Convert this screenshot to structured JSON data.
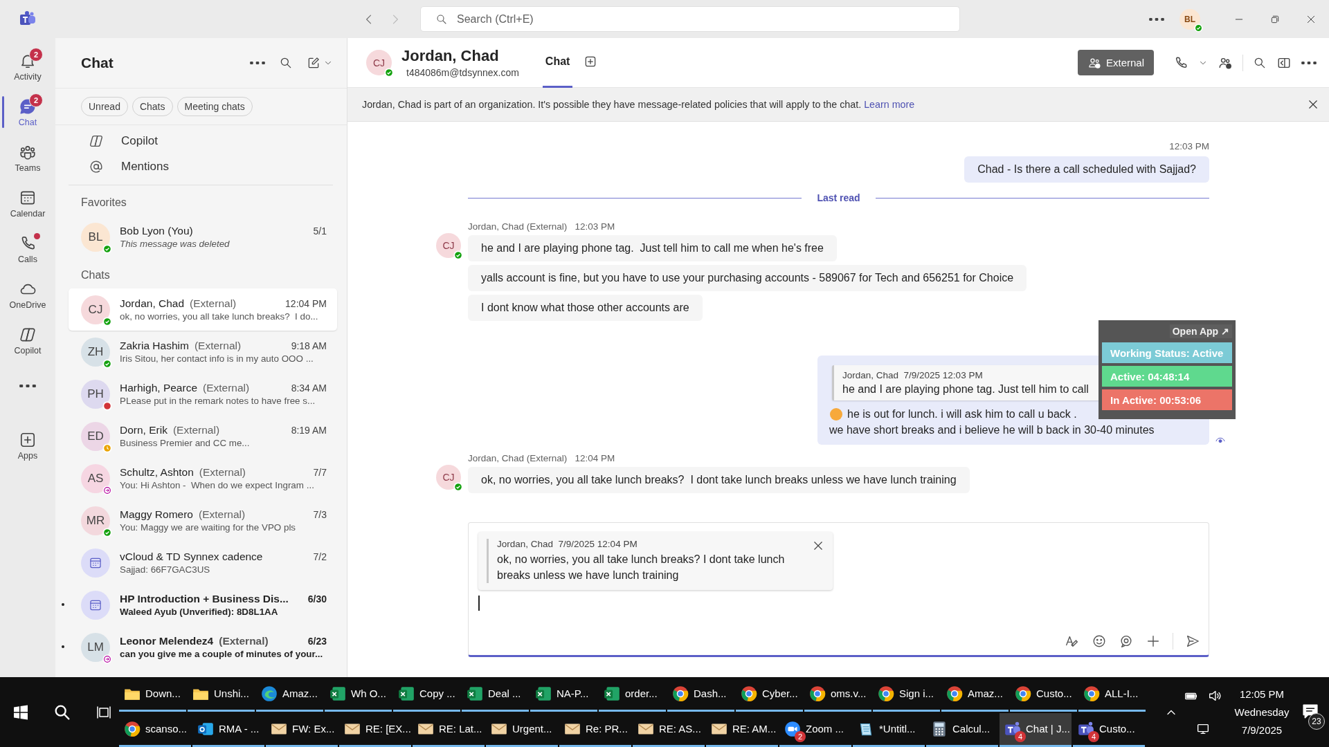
{
  "title_bar": {
    "search": {
      "placeholder": "Search (Ctrl+E)"
    },
    "profile": {
      "initials": "BL",
      "presence": {
        "kind": "available"
      }
    }
  },
  "app_rail": [
    {
      "kind": "bell",
      "label": "Activity",
      "badge": "2",
      "dot": false,
      "selected": false
    },
    {
      "kind": "chat",
      "label": "Chat",
      "badge": "2",
      "dot": false,
      "selected": true
    },
    {
      "kind": "teams",
      "label": "Teams",
      "dot": false,
      "selected": false
    },
    {
      "kind": "calendar",
      "label": "Calendar",
      "dot": false,
      "selected": false
    },
    {
      "kind": "phone",
      "label": "Calls",
      "dot": true,
      "selected": false
    },
    {
      "kind": "cloud",
      "label": "OneDrive",
      "dot": false,
      "selected": false
    },
    {
      "kind": "copilot",
      "label": "Copilot",
      "dot": false,
      "selected": false
    },
    {
      "kind": "more",
      "dot": false,
      "selected": false
    },
    {
      "kind": "apps",
      "label": "Apps",
      "dot": false,
      "selected": false
    }
  ],
  "chat_list": {
    "title": "Chat",
    "filters": [
      "Unread",
      "Chats",
      "Meeting chats"
    ],
    "shortcuts": [
      {
        "kind": "copilot",
        "label": "Copilot"
      },
      {
        "kind": "mention",
        "label": "Mentions"
      }
    ],
    "sections": [
      {
        "title": "Favorites",
        "items": [
          {
            "kind": "person",
            "initials": "BL",
            "color": "#fbe6d2",
            "name": "Bob Lyon (You)",
            "time": "5/1",
            "preview": "This message was deleted",
            "deleted": true,
            "presence": {
              "kind": "available"
            },
            "unread": false,
            "selected": false
          }
        ]
      },
      {
        "title": "Chats",
        "items": [
          {
            "kind": "person",
            "initials": "CJ",
            "color": "#f6d9dc",
            "name": "Jordan, Chad",
            "tag": "(External)",
            "time": "12:04 PM",
            "preview": "ok, no worries, you all take lunch breaks?  I do...",
            "deleted": false,
            "presence": {
              "kind": "available"
            },
            "unread": false,
            "selected": true
          },
          {
            "kind": "person",
            "initials": "ZH",
            "color": "#d7e1e7",
            "name": "Zakria Hashim",
            "tag": "(External)",
            "time": "9:18 AM",
            "preview": "Iris Sitou, her contact info is in my auto OOO ...",
            "deleted": false,
            "presence": {
              "kind": "available"
            },
            "unread": false,
            "selected": false
          },
          {
            "kind": "person",
            "initials": "PH",
            "color": "#ddd9ef",
            "name": "Harhigh, Pearce",
            "tag": "(External)",
            "time": "8:34 AM",
            "preview": "PLease put in the remark notes to have free s...",
            "deleted": false,
            "presence": {
              "kind": "busy"
            },
            "unread": false,
            "selected": false
          },
          {
            "kind": "person",
            "initials": "ED",
            "color": "#ecd6e6",
            "name": "Dorn, Erik",
            "tag": "(External)",
            "time": "8:19 AM",
            "preview": "Business Premier and CC me...",
            "deleted": false,
            "presence": {
              "kind": "away"
            },
            "unread": false,
            "selected": false
          },
          {
            "kind": "person",
            "initials": "AS",
            "color": "#f6d6e2",
            "name": "Schultz, Ashton",
            "tag": "(External)",
            "time": "7/7",
            "preview": "You: Hi Ashton -  When do we expect Ingram ...",
            "deleted": false,
            "presence": {
              "kind": "out-of-office"
            },
            "unread": false,
            "selected": false
          },
          {
            "kind": "person",
            "initials": "MR",
            "color": "#f3d8dd",
            "name": "Maggy Romero",
            "tag": "(External)",
            "time": "7/3",
            "preview": "You: Maggy we are waiting for the VPO pls",
            "deleted": false,
            "presence": {
              "kind": "available"
            },
            "unread": false,
            "selected": false
          },
          {
            "kind": "meeting",
            "color": "#dcdcf8",
            "name": "vCloud & TD Synnex cadence",
            "time": "7/2",
            "preview": "Sajjad: 66F7GAC3US",
            "deleted": false,
            "unread": false,
            "selected": false
          },
          {
            "kind": "meeting",
            "color": "#dcdcf8",
            "name": "HP Introduction + Business Dis...",
            "time": "6/30",
            "preview": "Waleed Ayub (Unverified): 8D8L1AA",
            "deleted": false,
            "unread": true,
            "selected": false
          },
          {
            "kind": "person",
            "initials": "LM",
            "color": "#d7e1e7",
            "name": "Leonor Melendez4",
            "tag": "(External)",
            "time": "6/23",
            "preview": "can you give me a couple of minutes of your...",
            "deleted": false,
            "presence": {
              "kind": "out-of-office"
            },
            "unread": true,
            "selected": false
          }
        ]
      }
    ]
  },
  "conversation": {
    "contact": {
      "initials": "CJ",
      "name": "Jordan, Chad",
      "email": "t484086m@tdsynnex.com",
      "presence": {
        "kind": "available"
      }
    },
    "tabs": [
      {
        "label": "Chat",
        "selected": true
      }
    ],
    "external_button": "External",
    "notice": {
      "text": "Jordan, Chad is part of an organization. It's possible they have message-related policies that will apply to the chat.",
      "link": "Learn more"
    },
    "messages": [
      {
        "kind": "outgoing",
        "time": "12:03 PM",
        "text": "Chad - Is there a call scheduled with Sajjad?"
      },
      {
        "kind": "divider",
        "text": "Last read"
      },
      {
        "kind": "incoming",
        "author": "Jordan, Chad (External)",
        "time": "12:03 PM",
        "initials": "CJ",
        "presence": {
          "kind": "available"
        },
        "bubbles": [
          "he and I are playing phone tag.  Just tell him to call me when he's free",
          "yalls account is fine, but you have to use your purchasing accounts - 589067 for Tech and 656251 for Choice",
          "I dont know what those other accounts are"
        ]
      },
      {
        "kind": "reply",
        "quote": {
          "author": "Jordan, Chad",
          "time": "7/9/2025 12:03 PM",
          "text": "he and I are playing phone tag. Just tell him to call"
        },
        "lines": [
          "he is out for lunch. i will ask him to call u back .",
          "we have short breaks and i believe he will b back in 30-40 minutes"
        ],
        "seen": true
      },
      {
        "kind": "incoming",
        "author": "Jordan, Chad (External)",
        "time": "12:04 PM",
        "initials": "CJ",
        "presence": {
          "kind": "available"
        },
        "bubbles": [
          "ok, no worries, you all take lunch breaks?  I dont take lunch breaks unless we have lunch training"
        ]
      }
    ],
    "composer": {
      "quote": {
        "author": "Jordan, Chad",
        "time": "7/9/2025 12:04 PM",
        "text": "ok, no worries, you all take lunch breaks? I dont take lunch breaks unless we have lunch training"
      }
    }
  },
  "status_overlay": {
    "link": "Open App ↗",
    "rows": [
      {
        "text": "Working Status: Active",
        "color": "#7ccbd6"
      },
      {
        "text": "Active: 04:48:14",
        "color": "#5fd98e"
      },
      {
        "text": "In Active: 00:53:06",
        "color": "#ec7468"
      }
    ]
  },
  "taskbar": {
    "upper_windows": [
      {
        "kind": "folder",
        "label": "Down...",
        "selected": false
      },
      {
        "kind": "folder",
        "label": "Unshi...",
        "selected": false
      },
      {
        "kind": "edge",
        "label": "Amaz...",
        "selected": false
      },
      {
        "kind": "excel",
        "label": "Wh O...",
        "selected": false
      },
      {
        "kind": "excel",
        "label": "Copy ...",
        "selected": false
      },
      {
        "kind": "excel",
        "label": "Deal ...",
        "selected": false
      },
      {
        "kind": "excel",
        "label": "NA-P...",
        "selected": false
      },
      {
        "kind": "excel",
        "label": "order...",
        "selected": false
      },
      {
        "kind": "chrome",
        "label": "Dash...",
        "selected": false
      },
      {
        "kind": "chrome",
        "label": "Cyber...",
        "selected": false
      },
      {
        "kind": "chrome",
        "label": "oms.v...",
        "selected": false
      },
      {
        "kind": "chrome",
        "label": "Sign i...",
        "selected": false
      },
      {
        "kind": "chrome",
        "label": "Amaz...",
        "selected": false
      },
      {
        "kind": "chrome",
        "label": "Custo...",
        "selected": false
      },
      {
        "kind": "chrome",
        "label": "ALL-I...",
        "selected": false
      }
    ],
    "lower_windows": [
      {
        "kind": "chrome",
        "label": "scanso...",
        "selected": false
      },
      {
        "kind": "outlook",
        "label": "RMA - ...",
        "selected": false
      },
      {
        "kind": "mail",
        "label": "FW: Ex...",
        "selected": false
      },
      {
        "kind": "mail",
        "label": "RE: [EX...",
        "selected": false
      },
      {
        "kind": "mail",
        "label": "RE: Lat...",
        "selected": false
      },
      {
        "kind": "mail",
        "label": "Urgent...",
        "selected": false
      },
      {
        "kind": "mail",
        "label": "Re: PR...",
        "selected": false
      },
      {
        "kind": "mail",
        "label": "RE: AS...",
        "selected": false
      },
      {
        "kind": "mail",
        "label": "RE: AM...",
        "selected": false
      },
      {
        "kind": "zoom",
        "label": "Zoom ...",
        "badge": "2",
        "selected": false
      },
      {
        "kind": "notepad",
        "label": "*Untitl...",
        "selected": false
      },
      {
        "kind": "calculator",
        "label": "Calcul...",
        "selected": false
      },
      {
        "kind": "teams",
        "label": "Chat | J...",
        "badge": "4",
        "selected": true
      },
      {
        "kind": "teams",
        "label": "Custo...",
        "badge": "4",
        "selected": false
      }
    ],
    "clock": {
      "time": "12:05 PM",
      "day": "Wednesday",
      "date": "7/9/2025"
    },
    "notifications": "23"
  }
}
